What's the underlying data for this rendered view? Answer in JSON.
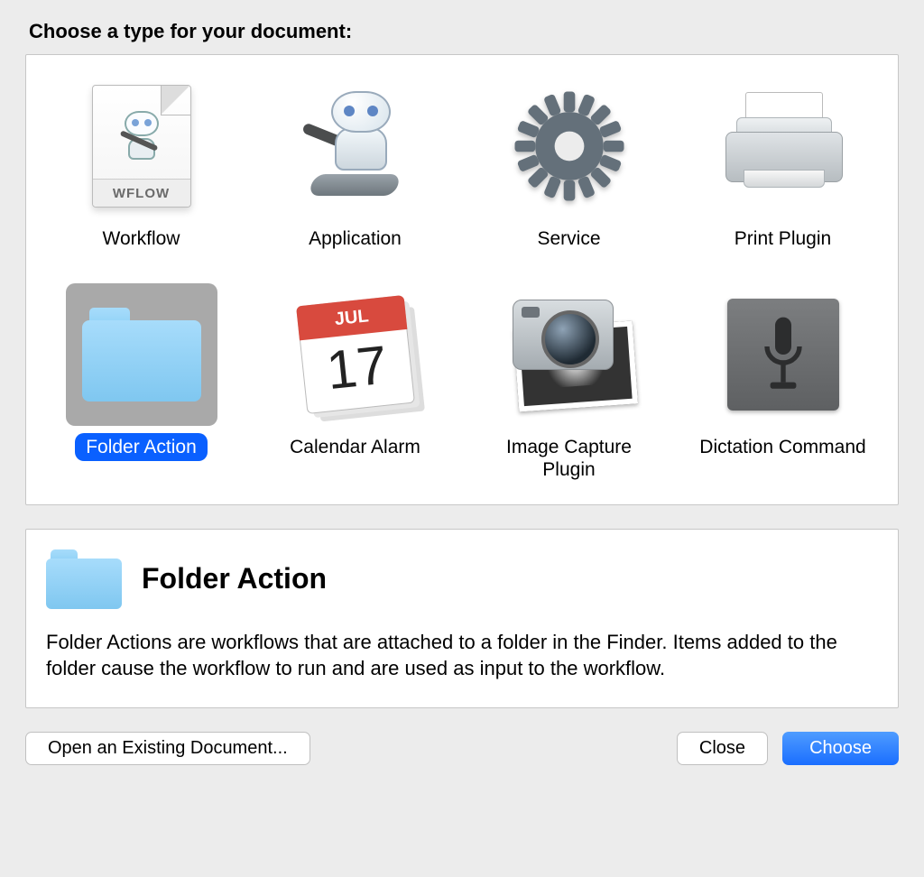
{
  "heading": "Choose a type for your document:",
  "types": [
    {
      "id": "workflow",
      "label": "Workflow",
      "selected": false
    },
    {
      "id": "application",
      "label": "Application",
      "selected": false
    },
    {
      "id": "service",
      "label": "Service",
      "selected": false
    },
    {
      "id": "print-plugin",
      "label": "Print Plugin",
      "selected": false
    },
    {
      "id": "folder-action",
      "label": "Folder Action",
      "selected": true
    },
    {
      "id": "calendar-alarm",
      "label": "Calendar Alarm",
      "selected": false
    },
    {
      "id": "image-capture-plugin",
      "label": "Image Capture Plugin",
      "selected": false
    },
    {
      "id": "dictation-command",
      "label": "Dictation Command",
      "selected": false
    }
  ],
  "calendar_icon": {
    "month": "JUL",
    "day": "17"
  },
  "workflow_icon_band": "WFLOW",
  "description": {
    "title": "Folder Action",
    "body": "Folder Actions are workflows that are attached to a folder in the Finder. Items added to the folder cause the workflow to run and are used as input to the workflow."
  },
  "buttons": {
    "open_existing": "Open an Existing Document...",
    "close": "Close",
    "choose": "Choose"
  }
}
